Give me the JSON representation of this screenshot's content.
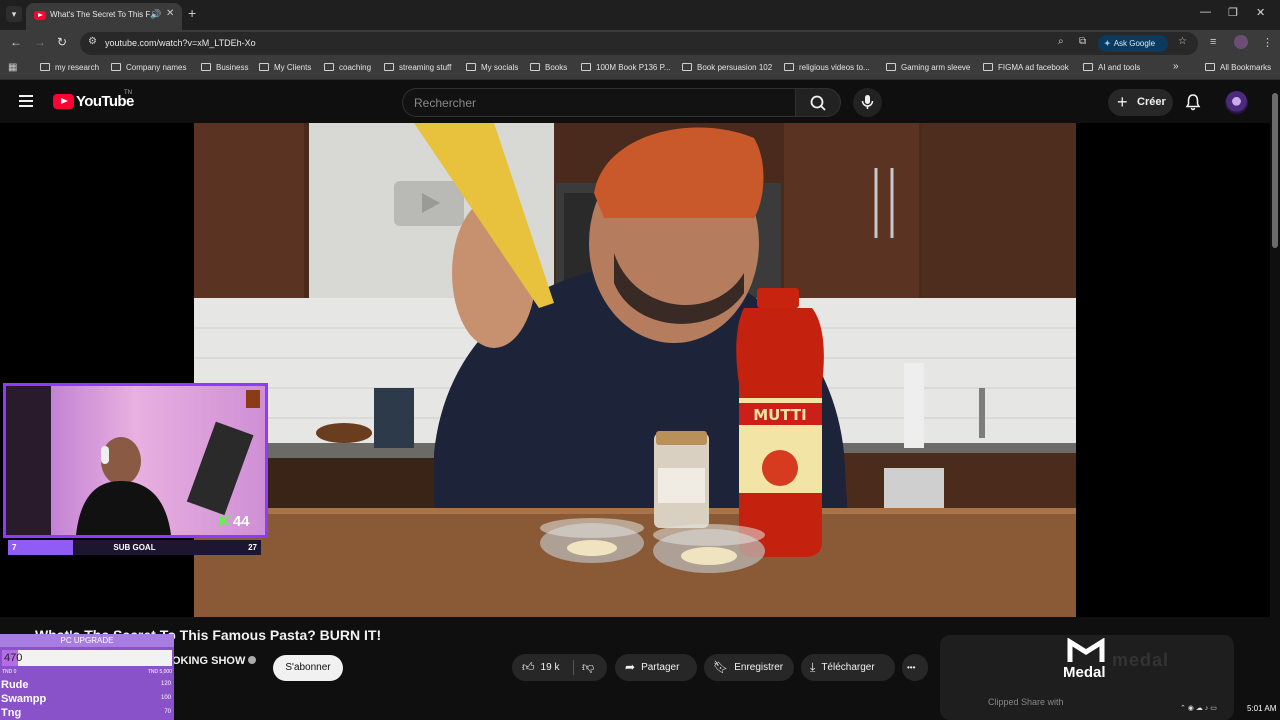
{
  "browser": {
    "tab_title": "What's The Secret To This F",
    "url": "youtube.com/watch?v=xM_LTDEh-Xo",
    "ask_google": "Ask Google",
    "bookmarks": [
      "my research",
      "Company names",
      "Business",
      "My Clients",
      "coaching",
      "streaming stuff",
      "My socials",
      "Books",
      "100M Book P136 P...",
      "Book persuasion 102",
      "religious videos to...",
      "Gaming arm sleeve",
      "FIGMA ad facebook",
      "AI and tools"
    ],
    "more_bookmarks": "»",
    "all_bookmarks": "All Bookmarks"
  },
  "youtube": {
    "logo_text": "YouTube",
    "country_code": "TN",
    "search_placeholder": "Rechercher",
    "create_label": "Créer"
  },
  "video": {
    "title": "What's The Secret To This Famous Pasta? BURN IT!",
    "channel_name_visible": "OKING SHOW",
    "subscribe_label": "S'abonner",
    "likes": "19 k",
    "share_label": "Partager",
    "save_label": "Enregistrer",
    "download_label": "Télécharger",
    "more_label": "•••"
  },
  "overlay": {
    "sub_goal_label": "SUB GOAL",
    "sub_goal_current": "7",
    "sub_goal_target": "27",
    "kick_count": "44",
    "pc_upgrade_label": "PC UPGRADE",
    "pc_amount": "470",
    "pc_progress_fraction": 0.094,
    "pc_min": "TND 0",
    "pc_max": "TND 5,000",
    "leaderboard": [
      {
        "name": "Rude",
        "value": "120"
      },
      {
        "name": "Swampp",
        "value": "100"
      },
      {
        "name": "Tng",
        "value": "70"
      }
    ]
  },
  "recommended": {
    "brand": "Medal",
    "bg_text": "medal",
    "visible_text": "Clipped Share with"
  },
  "system": {
    "time": "5:01 AM"
  },
  "colors": {
    "youtube_red": "#ff0033",
    "overlay_purple": "#8b3cff",
    "kick_green": "#52ff3a"
  }
}
